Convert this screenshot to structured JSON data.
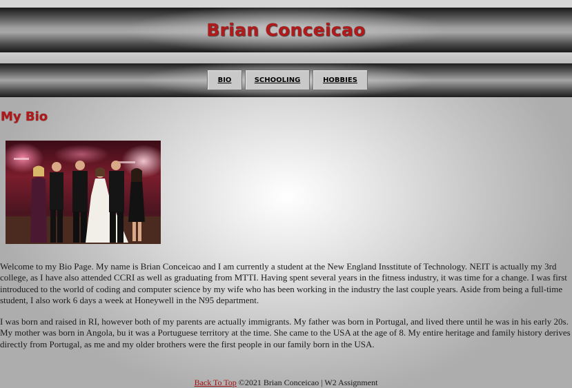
{
  "header": {
    "title": "Brian Conceicao"
  },
  "nav": {
    "items": [
      {
        "label": "BIO"
      },
      {
        "label": "SCHOOLING"
      },
      {
        "label": "HOBBIES"
      }
    ]
  },
  "main": {
    "heading": "My Bio",
    "photo_alt": "Group photo of six people at a wedding reception",
    "paragraphs": [
      "Welcome to my Bio Page. My name is Brian Conceicao and I am currently a student at the New England Insstitute of Technology. NEIT is actually my 3rd college, as I have also attended CCRI as well as graduating from MTTI. Having spent several years in the fitness industry, it was time for a change. I was first introduced to the world of coding and computer science by my wife who has been working in the industry the last couple years. Aside from being a full-time student, I also work 6 days a week at Honeywell in the N95 department.",
      "I was born and raised in RI, however both of my parents are actually immigrants. My father was born in Portugal, and lived there until he was in his early 20s. My mother was born in Angola, bu it was a Portuguese territory at the time. She came to the USA at the age of 8. My entire heritage and family history derives directly from Portugal, as me and my older brothers were the first people in our family born in the USA."
    ]
  },
  "footer": {
    "back_to_top": "Back To Top",
    "copyright": "©2021 Brian Conceicao | W2 Assignment"
  },
  "colors": {
    "accent": "#b11a1a",
    "link": "#a01010"
  }
}
